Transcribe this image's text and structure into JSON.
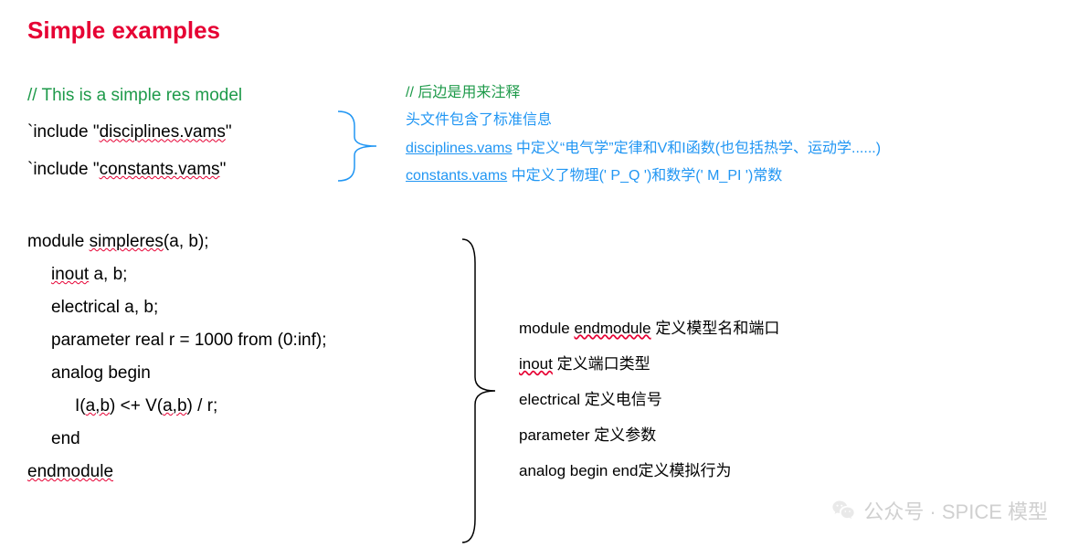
{
  "title": "Simple examples",
  "code_top": {
    "comment": "// This is a simple res model",
    "inc_prefix1": "`include \"",
    "inc_file1": "disciplines.vams",
    "inc_suffix1": "\"",
    "inc_prefix2": "`include \"",
    "inc_file2": "constants.vams",
    "inc_suffix2": "\""
  },
  "module": {
    "l0a": "module ",
    "l0b": "simpleres",
    "l0c": "(a, b);",
    "l1a": "inout",
    "l1b": " a, b;",
    "l2": "electrical a, b;",
    "l3": "parameter real r = 1000 from (0:inf);",
    "l4": "analog begin",
    "l5a": "I(",
    "l5b": "a,b",
    "l5c": ") <+ V(",
    "l5d": "a,b",
    "l5e": ") / r;",
    "l6": "end",
    "l7": "endmodule"
  },
  "annot_top": {
    "a1": "// 后边是用来注释",
    "a2": "头文件包含了标准信息",
    "a3a": "disciplines.vams",
    "a3b": " 中定义“电气学”定律和V和I函数(也包括热学、运动学......)",
    "a4a": "constants.vams",
    "a4b": " 中定义了物理(' P_Q ')和数学(' M_PI ')常数"
  },
  "annot_right": {
    "r1a": "module  ",
    "r1b": "endmodule",
    "r1c": " 定义模型名和端口",
    "r2a": "inout",
    "r2b": " 定义端口类型",
    "r3": "electrical 定义电信号",
    "r4": "parameter 定义参数",
    "r5": "analog begin end定义模拟行为"
  },
  "watermark": "公众号 · SPICE 模型"
}
